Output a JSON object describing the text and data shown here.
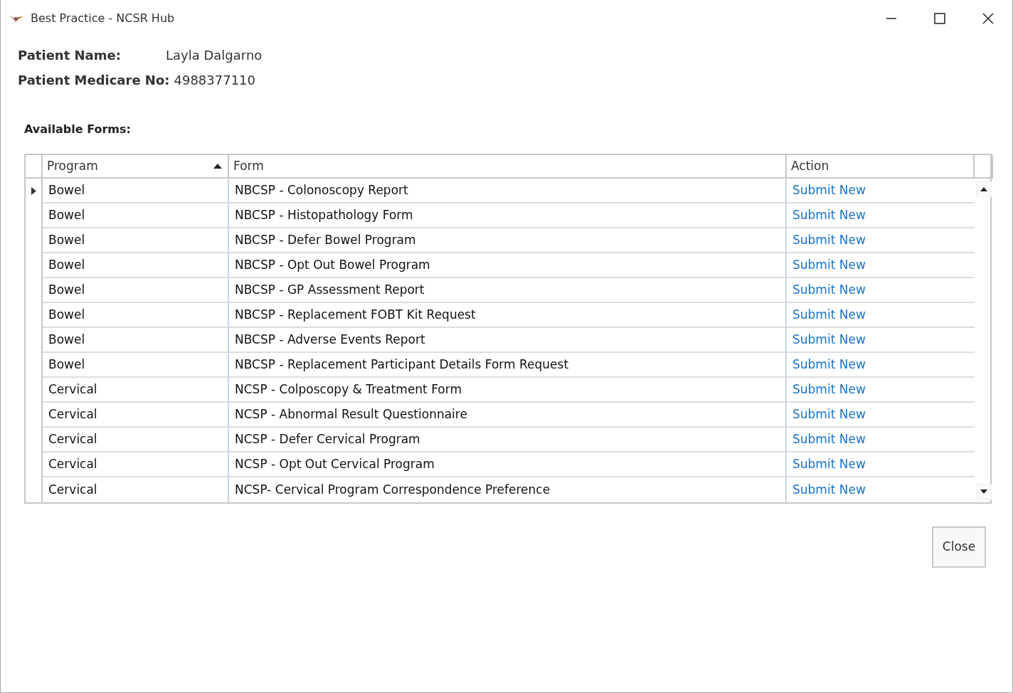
{
  "window": {
    "title": "Best Practice - NCSR Hub"
  },
  "patient": [
    {
      "label": "Patient Name:",
      "value": "Layla Dalgarno"
    },
    {
      "label": "Patient Medicare No:",
      "value": "4988377110"
    }
  ],
  "forms_label": "Available Forms:",
  "table": {
    "columns": [
      {
        "label": "Program",
        "sorted": true
      },
      {
        "label": "Form",
        "sorted": false
      },
      {
        "label": "Action",
        "sorted": false
      }
    ],
    "rows": [
      {
        "program": "Bowel",
        "form": "NBCSP - Colonoscopy Report",
        "action": "Submit New",
        "selected": true
      },
      {
        "program": "Bowel",
        "form": "NBCSP - Histopathology Form",
        "action": "Submit New",
        "selected": false
      },
      {
        "program": "Bowel",
        "form": "NBCSP - Defer Bowel Program",
        "action": "Submit New",
        "selected": false
      },
      {
        "program": "Bowel",
        "form": "NBCSP - Opt Out Bowel Program",
        "action": "Submit New",
        "selected": false
      },
      {
        "program": "Bowel",
        "form": "NBCSP - GP Assessment Report",
        "action": "Submit New",
        "selected": false
      },
      {
        "program": "Bowel",
        "form": "NBCSP - Replacement FOBT Kit Request",
        "action": "Submit New",
        "selected": false
      },
      {
        "program": "Bowel",
        "form": "NBCSP - Adverse Events Report",
        "action": "Submit New",
        "selected": false
      },
      {
        "program": "Bowel",
        "form": "NBCSP - Replacement Participant Details Form Request",
        "action": "Submit New",
        "selected": false
      },
      {
        "program": "Cervical",
        "form": "NCSP - Colposcopy & Treatment Form",
        "action": "Submit New",
        "selected": false
      },
      {
        "program": "Cervical",
        "form": "NCSP - Abnormal Result Questionnaire",
        "action": "Submit New",
        "selected": false
      },
      {
        "program": "Cervical",
        "form": "NCSP - Defer Cervical Program",
        "action": "Submit New",
        "selected": false
      },
      {
        "program": "Cervical",
        "form": "NCSP - Opt Out Cervical Program",
        "action": "Submit New",
        "selected": false
      },
      {
        "program": "Cervical",
        "form": "NCSP- Cervical Program Correspondence Preference",
        "action": "Submit New",
        "selected": false
      }
    ]
  },
  "buttons": [
    {
      "label": "Close"
    }
  ]
}
